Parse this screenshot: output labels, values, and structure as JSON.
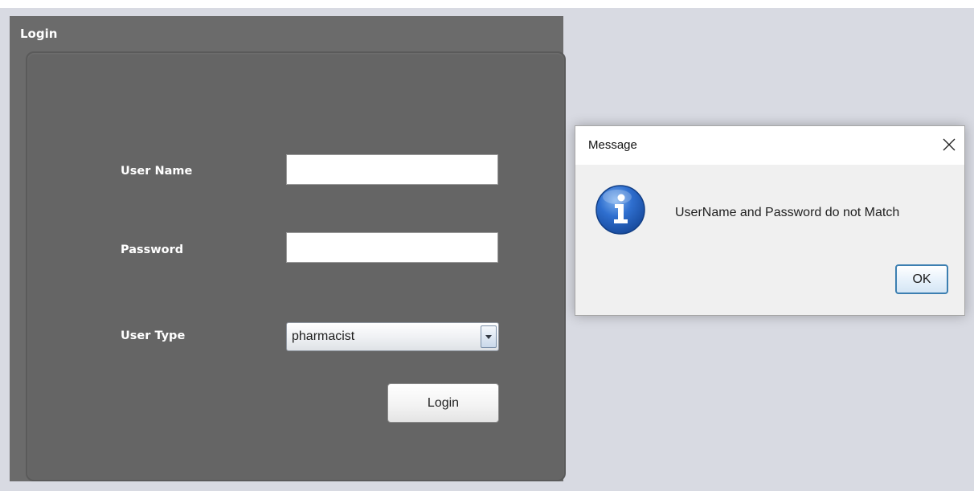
{
  "login_frame": {
    "title": "Login",
    "fields": {
      "username_label": "User Name",
      "username_value": "",
      "password_label": "Password",
      "password_value": "",
      "usertype_label": "User Type",
      "usertype_selected": "pharmacist"
    },
    "login_button_label": "Login"
  },
  "dialog": {
    "title": "Message",
    "message": "UserName and Password do not Match",
    "ok_label": "OK",
    "icon": "info-icon"
  },
  "colors": {
    "frame_bg": "#6b6b6b",
    "panel_bg": "#656565",
    "window_bg": "#d8dae2",
    "dialog_bg": "#f0f0f0",
    "info_icon_blue": "#1f5fb8",
    "ok_border": "#3c7fb1"
  }
}
